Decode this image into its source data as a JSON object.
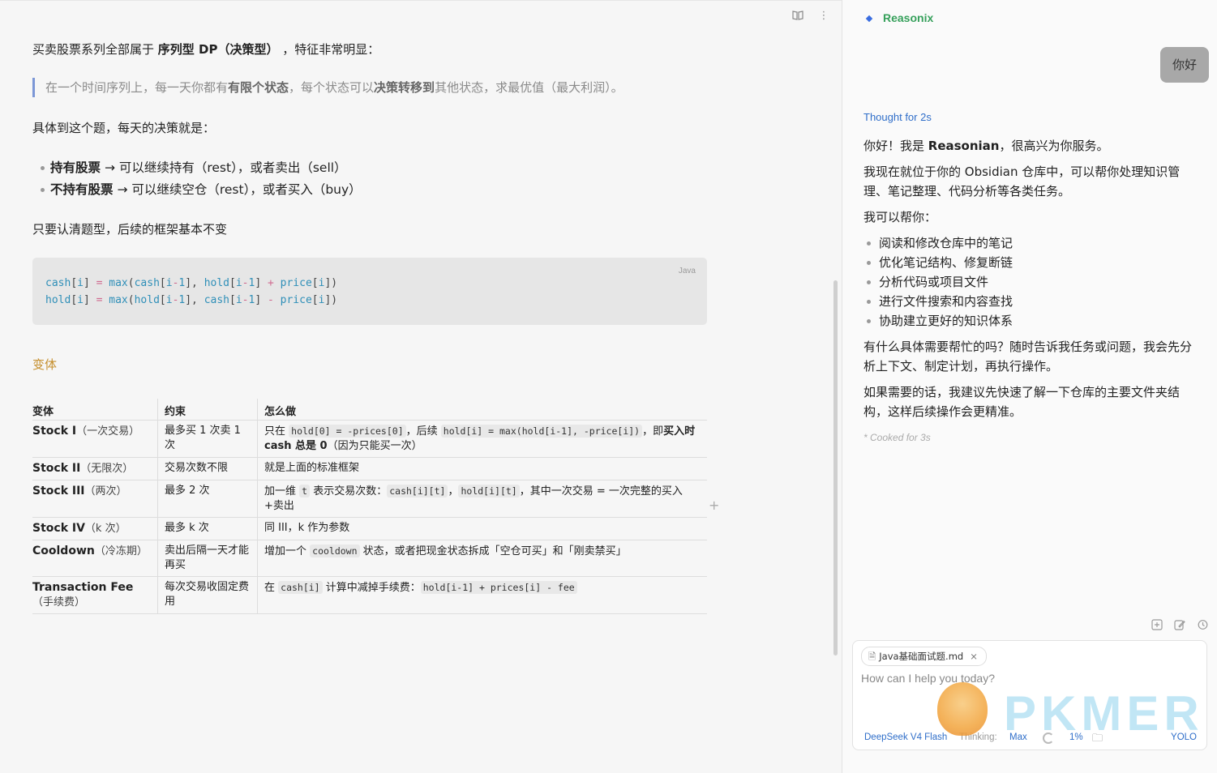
{
  "note": {
    "intro_prefix": "买卖股票系列全部属于",
    "intro_bold": "序列型 DP（决策型）",
    "intro_suffix": "，特征非常明显：",
    "quote": {
      "part1": "在一个时间序列上，每一天你都有",
      "bold1": "有限个状态",
      "part2": "，每个状态可以",
      "bold2": "决策转移到",
      "part3": "其他状态，求最优值（最大利润）。"
    },
    "daily": "具体到这个题，每天的决策就是：",
    "bullets": [
      {
        "bold": "持有股票",
        "text": " → 可以继续持有（rest），或者卖出（sell）"
      },
      {
        "bold": "不持有股票",
        "text": " → 可以继续空仓（rest），或者买入（buy）"
      }
    ],
    "frame": "只要认清题型，后续的框架基本不变",
    "code": {
      "lang": "Java",
      "lines": [
        "cash[i] = max(cash[i-1], hold[i-1] + price[i])",
        "hold[i] = max(hold[i-1], cash[i-1] - price[i])"
      ]
    },
    "variant_heading": "变体",
    "table": {
      "headers": [
        "变体",
        "约束",
        "怎么做"
      ],
      "rows": [
        {
          "name": "Stock I",
          "sub": "（一次交易）",
          "constraint": "最多买 1 次卖 1 次",
          "how": [
            "只在 ",
            {
              "code": "hold[0] = -prices[0]"
            },
            "，后续 ",
            {
              "code": "hold[i] = max(hold[i-1], -price[i])"
            },
            "，即",
            {
              "bold": "买入时 cash 总是 0"
            },
            "（因为只能买一次）"
          ]
        },
        {
          "name": "Stock II",
          "sub": "（无限次）",
          "constraint": "交易次数不限",
          "how": [
            "就是上面的标准框架"
          ]
        },
        {
          "name": "Stock III",
          "sub": "（两次）",
          "constraint": "最多 2 次",
          "how": [
            "加一维 ",
            {
              "code": "t"
            },
            " 表示交易次数：",
            {
              "code": "cash[i][t]"
            },
            "，",
            {
              "code": "hold[i][t]"
            },
            "，其中一次交易 = 一次完整的买入+卖出"
          ]
        },
        {
          "name": "Stock IV",
          "sub": "（k 次）",
          "constraint": "最多 k 次",
          "how": [
            "同 III，k 作为参数"
          ]
        },
        {
          "name": "Cooldown",
          "sub": "（冷冻期）",
          "constraint": "卖出后隔一天才能再买",
          "how": [
            "增加一个 ",
            {
              "code": "cooldown"
            },
            " 状态，或者把现金状态拆成「空仓可买」和「刚卖禁买」"
          ]
        },
        {
          "name": "Transaction Fee",
          "sub": "（手续费）",
          "constraint": "每次交易收固定费用",
          "how": [
            "在 ",
            {
              "code": "cash[i]"
            },
            " 计算中减掉手续费：",
            {
              "code": "hold[i-1] + prices[i] - fee"
            }
          ]
        }
      ]
    }
  },
  "chat": {
    "app_name": "Reasonix",
    "user_message": "你好",
    "thought_label": "Thought for 2s",
    "reply": {
      "greeting_prefix": "你好！我是 ",
      "greeting_bold": "Reasonian",
      "greeting_suffix": "，很高兴为你服务。",
      "p2": "我现在就位于你的 Obsidian 仓库中，可以帮你处理知识管理、笔记整理、代码分析等各类任务。",
      "p3": "我可以帮你：",
      "list": [
        "阅读和修改仓库中的笔记",
        "优化笔记结构、修复断链",
        "分析代码或项目文件",
        "进行文件搜索和内容查找",
        "协助建立更好的知识体系"
      ],
      "p4": "有什么具体需要帮忙的吗？随时告诉我任务或问题，我会先分析上下文、制定计划，再执行操作。",
      "p5": "如果需要的话，我建议先快速了解一下仓库的主要文件夹结构，这样后续操作会更精准。"
    },
    "cooked": "* Cooked for 3s",
    "composer": {
      "file_chip": "Java基础面试题.md",
      "placeholder": "How can I help you today?",
      "model": "DeepSeek V4 Flash",
      "thinking_label": "Thinking:",
      "thinking_value": "Max",
      "context_pct": "1%",
      "mode": "YOLO"
    }
  },
  "watermark": "PKMER",
  "icons": [
    "book-open-icon",
    "more-vertical-icon",
    "new-chat-icon",
    "edit-icon",
    "history-icon",
    "file-icon",
    "close-icon",
    "folder-icon",
    "spinner-icon",
    "plus-icon"
  ]
}
